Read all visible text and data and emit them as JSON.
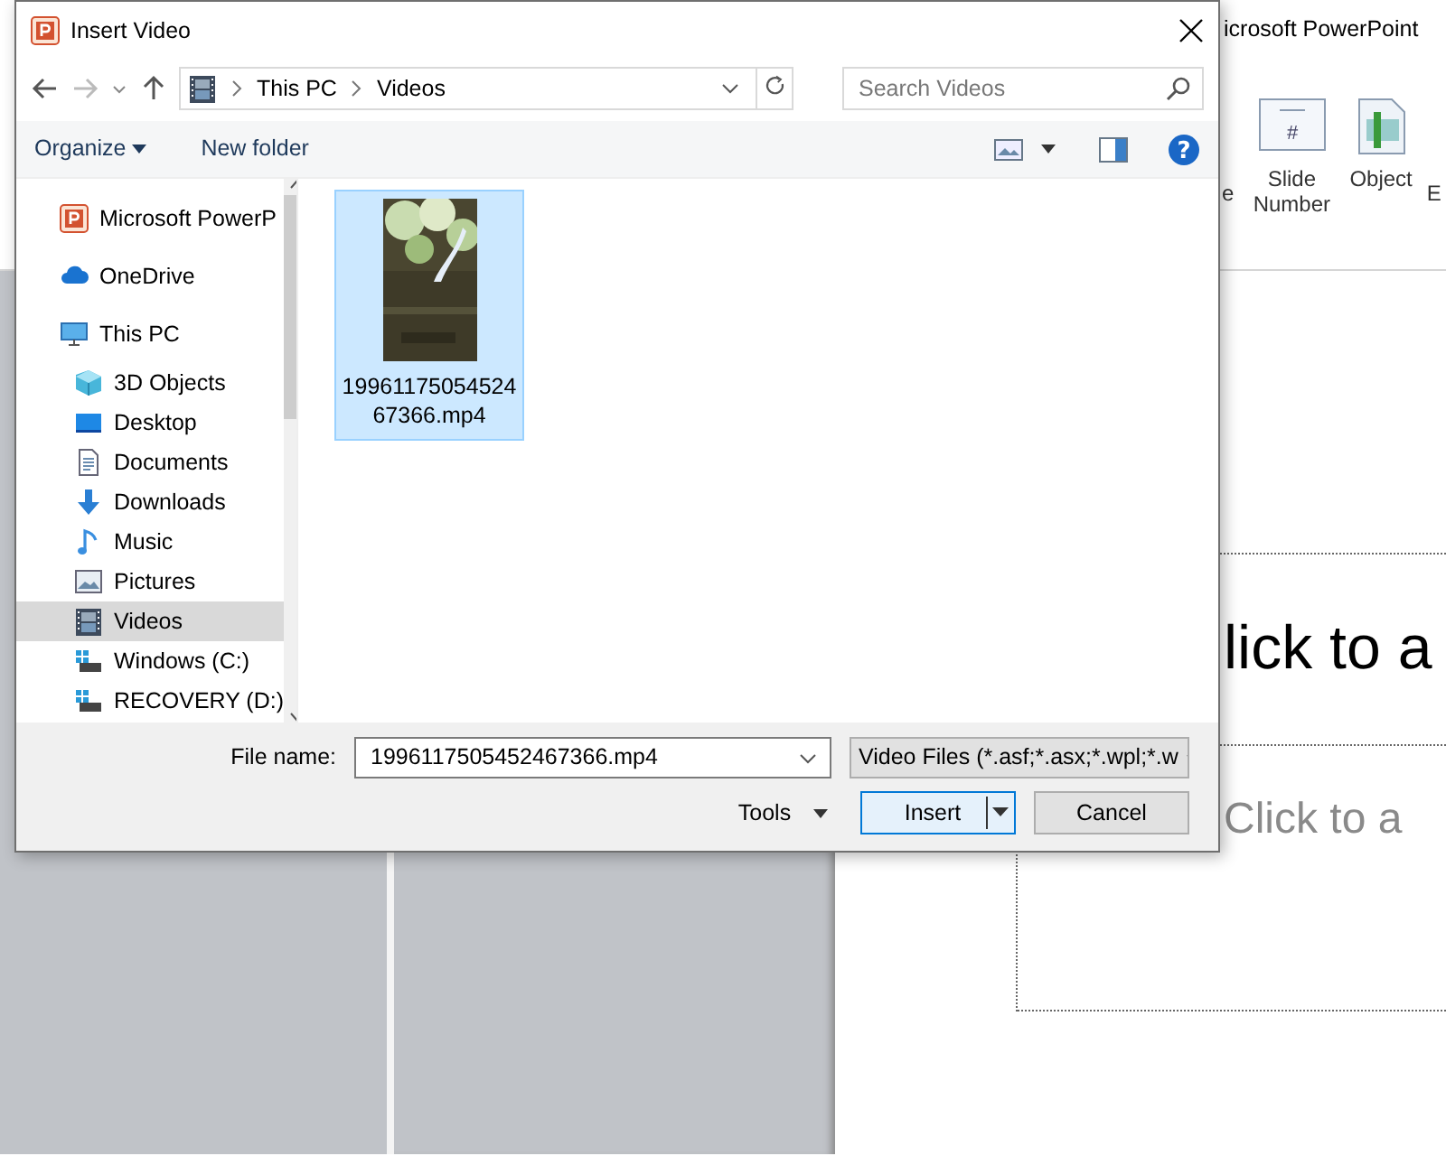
{
  "background_app": {
    "title": "icrosoft PowerPoint",
    "ribbon_items": [
      {
        "label": "e",
        "kind": "partial"
      },
      {
        "label": "Slide Number",
        "kind": "slide-number",
        "glyph": "#"
      },
      {
        "label": "Object",
        "kind": "object"
      },
      {
        "label": "E",
        "kind": "partial"
      }
    ],
    "slide": {
      "title_placeholder": "lick to a",
      "subtitle_placeholder": "Click to a"
    }
  },
  "dialog": {
    "title": "Insert Video",
    "breadcrumb": [
      "This PC",
      "Videos"
    ],
    "search": {
      "placeholder": "Search Videos"
    },
    "toolbar": {
      "organize": "Organize",
      "new_folder": "New folder",
      "help": "?"
    },
    "nav_items": [
      {
        "label": "Microsoft PowerP",
        "kind": "powerpoint",
        "selected": false
      },
      {
        "label": "OneDrive",
        "kind": "cloud",
        "selected": false
      },
      {
        "label": "This PC",
        "kind": "pc",
        "selected": false,
        "children": [
          {
            "label": "3D Objects",
            "kind": "cube",
            "selected": false
          },
          {
            "label": "Desktop",
            "kind": "desktop",
            "selected": false
          },
          {
            "label": "Documents",
            "kind": "document",
            "selected": false
          },
          {
            "label": "Downloads",
            "kind": "download",
            "selected": false
          },
          {
            "label": "Music",
            "kind": "music",
            "selected": false
          },
          {
            "label": "Pictures",
            "kind": "pictures",
            "selected": false
          },
          {
            "label": "Videos",
            "kind": "video",
            "selected": true
          },
          {
            "label": "Windows (C:)",
            "kind": "drive",
            "selected": false
          },
          {
            "label": "RECOVERY (D:)",
            "kind": "drive",
            "selected": false
          }
        ]
      }
    ],
    "files": [
      {
        "name": "1996117505452467366.mp4",
        "kind": "picture",
        "selected": true
      }
    ],
    "file_name_label": "File name:",
    "file_name": "1996117505452467366.mp4",
    "file_type": "Video Files (*.asf;*.asx;*.wpl;*.w",
    "buttons": [
      {
        "label": "Tools",
        "kind": "menu",
        "default": false
      },
      {
        "label": "Insert",
        "kind": "split",
        "default": true
      },
      {
        "label": "Cancel",
        "kind": "plain",
        "default": false
      }
    ]
  }
}
